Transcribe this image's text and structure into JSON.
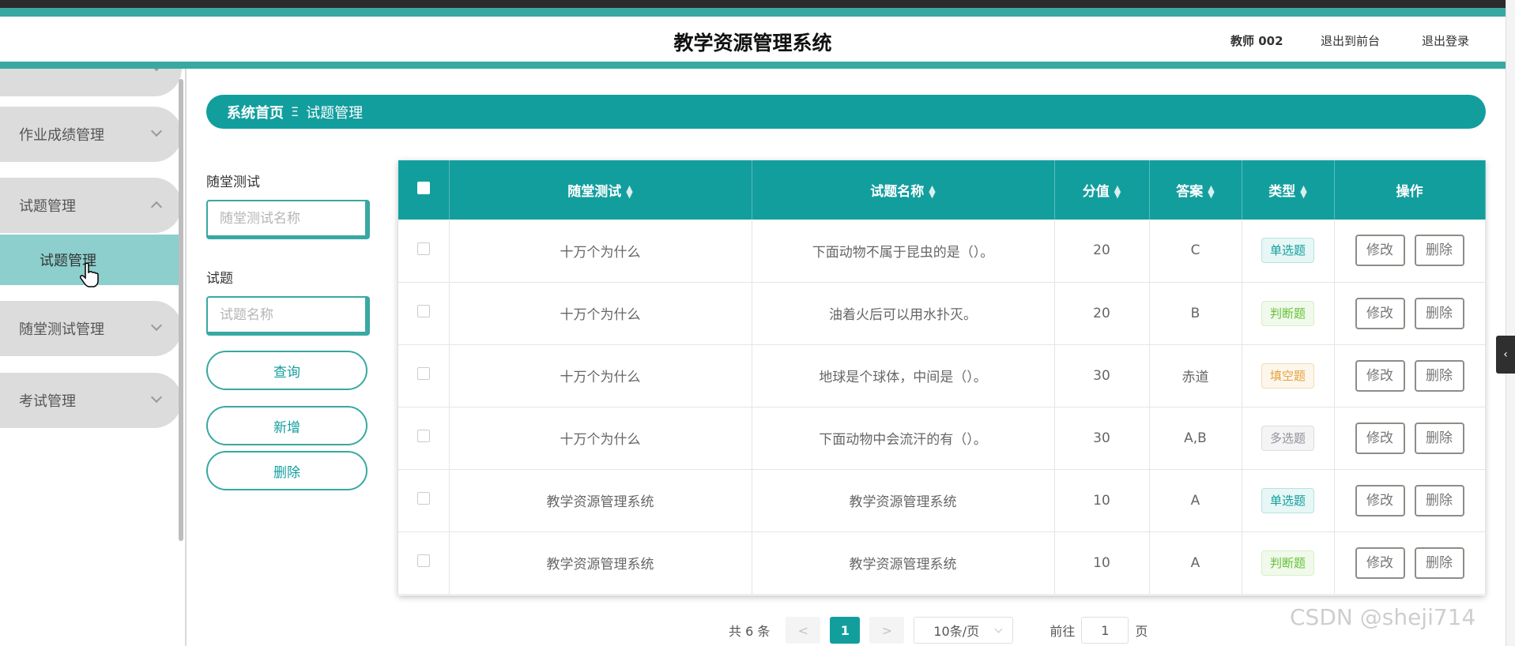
{
  "header": {
    "title": "教学资源管理系统",
    "user": "教师 002",
    "front_link": "退出到前台",
    "logout_link": "退出登录"
  },
  "sidebar": {
    "items": [
      {
        "label": "作业成绩管理"
      },
      {
        "label": "试题管理"
      },
      {
        "label": "随堂测试管理"
      },
      {
        "label": "考试管理"
      }
    ],
    "active_sub": "试题管理"
  },
  "breadcrumb": {
    "home": "系统首页",
    "separator": "Ξ",
    "current": "试题管理"
  },
  "search": {
    "test_label": "随堂测试",
    "test_placeholder": "随堂测试名称",
    "question_label": "试题",
    "question_placeholder": "试题名称",
    "query_button": "查询",
    "add_button": "新增",
    "delete_button": "删除"
  },
  "table": {
    "columns": [
      "随堂测试",
      "试题名称",
      "分值",
      "答案",
      "类型",
      "操作"
    ],
    "edit_label": "修改",
    "delete_label": "删除",
    "rows": [
      {
        "test": "十万个为什么",
        "question": "下面动物不属于昆虫的是（）。",
        "score": "20",
        "answer": "C",
        "type": "单选题"
      },
      {
        "test": "十万个为什么",
        "question": "油着火后可以用水扑灭。",
        "score": "20",
        "answer": "B",
        "type": "判断题"
      },
      {
        "test": "十万个为什么",
        "question": "地球是个球体，中间是（）。",
        "score": "30",
        "answer": "赤道",
        "type": "填空题"
      },
      {
        "test": "十万个为什么",
        "question": "下面动物中会流汗的有（）。",
        "score": "30",
        "answer": "A,B",
        "type": "多选题"
      },
      {
        "test": "教学资源管理系统",
        "question": "教学资源管理系统",
        "score": "10",
        "answer": "A",
        "type": "单选题"
      },
      {
        "test": "教学资源管理系统",
        "question": "教学资源管理系统",
        "score": "10",
        "answer": "A",
        "type": "判断题"
      }
    ]
  },
  "pagination": {
    "total": "共 6 条",
    "prev": "<",
    "current_page": "1",
    "next": ">",
    "page_size": "10条/页",
    "goto_label": "前往",
    "goto_value": "1",
    "page_suffix": "页"
  },
  "watermark": "CSDN @sheji714",
  "side_toggle": "‹",
  "colors": {
    "accent": "#139e9e",
    "accent_light": "#39a8a2",
    "active_sub_bg": "#8ccfcd"
  }
}
